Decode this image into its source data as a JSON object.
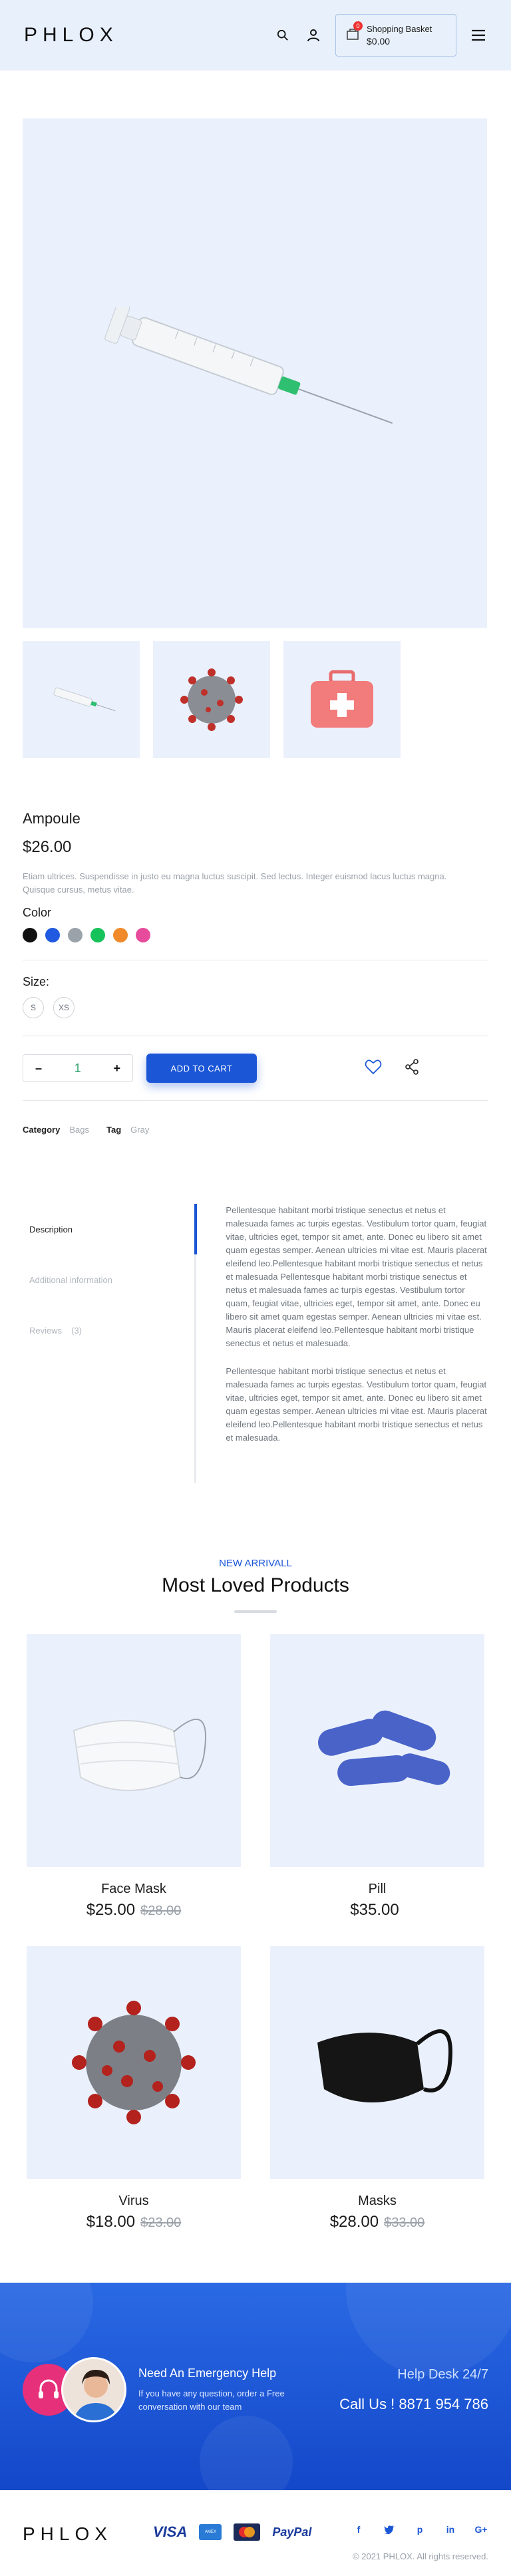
{
  "header": {
    "logo": "PHLOX",
    "basket_label": "Shopping Basket",
    "basket_total": "$0.00",
    "basket_count": "0",
    "icons": [
      "search-icon",
      "user-icon",
      "basket-icon",
      "menu-icon"
    ]
  },
  "product": {
    "title": "Ampoule",
    "price": "$26.00",
    "description": "Etiam ultrices. Suspendisse in justo eu magna luctus suscipit. Sed lectus. Integer euismod lacus luctus magna. Quisque cursus, metus vitae.",
    "color_label": "Color",
    "colors": [
      "#111111",
      "#1f5ae0",
      "#9aa3a9",
      "#16c25a",
      "#f08a2a",
      "#e74c9c"
    ],
    "size_label": "Size:",
    "sizes": [
      "S",
      "XS"
    ],
    "quantity": "1",
    "qty_minus": "–",
    "qty_plus": "+",
    "add_to_cart": "ADD TO CART",
    "category_label": "Category",
    "category_value": "Bags",
    "tag_label": "Tag",
    "tag_value": "Gray",
    "thumbnails": [
      "syringe",
      "virus",
      "first-aid-kit"
    ]
  },
  "tabs": {
    "items": [
      "Description",
      "Additional information",
      "Reviews",
      "(3)"
    ],
    "paragraph_1": "Pellentesque habitant morbi tristique senectus et netus et malesuada fames ac turpis egestas. Vestibulum tortor quam, feugiat vitae, ultricies eget, tempor sit amet, ante. Donec eu libero sit amet quam egestas semper. Aenean ultricies mi vitae est. Mauris placerat eleifend leo.Pellentesque habitant morbi tristique senectus et netus et malesuada Pellentesque habitant morbi tristique senectus et netus et malesuada fames ac turpis egestas. Vestibulum tortor quam, feugiat vitae, ultricies eget, tempor sit amet, ante. Donec eu libero sit amet quam egestas semper. Aenean ultricies mi vitae est. Mauris placerat eleifend leo.Pellentesque habitant morbi tristique senectus et netus et malesuada.",
    "paragraph_2": "Pellentesque habitant morbi tristique senectus et netus et malesuada fames ac turpis egestas. Vestibulum tortor quam, feugiat vitae, ultricies eget, tempor sit amet, ante. Donec eu libero sit amet quam egestas semper. Aenean ultricies mi vitae est. Mauris placerat eleifend leo.Pellentesque habitant morbi tristique senectus et netus et malesuada."
  },
  "loved": {
    "subtitle": "NEW ARRIVALL",
    "title": "Most Loved Products",
    "products": [
      {
        "name": "Face Mask",
        "price": "$25.00",
        "old_price": "$28.00"
      },
      {
        "name": "Pill",
        "price": "$35.00",
        "old_price": ""
      },
      {
        "name": "Virus",
        "price": "$18.00",
        "old_price": "$23.00"
      },
      {
        "name": "Masks",
        "price": "$28.00",
        "old_price": "$33.00"
      }
    ]
  },
  "help": {
    "title": "Need An Emergency Help",
    "description": "If you have any question, order a Free conversation with our team",
    "desk": "Help Desk 24/7",
    "phone": "Call Us ! 8871 954 786"
  },
  "footer": {
    "logo": "PHLOX",
    "payments": [
      "VISA",
      "AMEX",
      "MasterCard",
      "PayPal"
    ],
    "socials": [
      "f",
      "t",
      "p",
      "in",
      "G+"
    ],
    "copyright": "© 2021 PHLOX. All rights reserved."
  }
}
